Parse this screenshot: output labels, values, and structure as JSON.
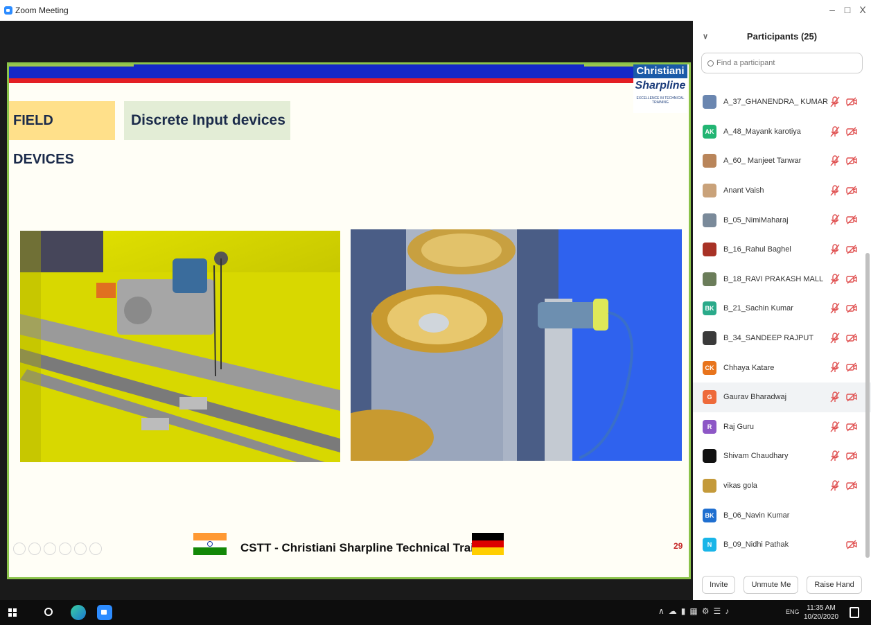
{
  "window": {
    "title": "Zoom Meeting",
    "minimize": "–",
    "restore": "□",
    "close": "X"
  },
  "slide": {
    "brand_top": "Christiani",
    "brand_mid": "Sharpline",
    "brand_small": "EXCELLENCE IN TECHNICAL TRAINING",
    "label_field": "FIELD DEVICES",
    "label_discrete": "Discrete Input devices",
    "footer_text": "CSTT - Christiani Sharpline Technical Training",
    "page_number": "29"
  },
  "panel": {
    "title": "Participants (25)",
    "search_placeholder": "Find a participant",
    "buttons": {
      "invite": "Invite",
      "unmute": "Unmute Me",
      "raise_hand": "Raise Hand"
    }
  },
  "participants": [
    {
      "name": "A_37_GHANENDRA_ KUMAR",
      "initials": "",
      "color": "#6a86b0",
      "mic": true,
      "cam": true
    },
    {
      "name": "A_48_Mayank karotiya",
      "initials": "AK",
      "color": "#22b573",
      "mic": true,
      "cam": true
    },
    {
      "name": "A_60_ Manjeet Tanwar",
      "initials": "",
      "color": "#b9855a",
      "mic": true,
      "cam": true
    },
    {
      "name": "Anant Vaish",
      "initials": "",
      "color": "#c9a27a",
      "mic": true,
      "cam": true
    },
    {
      "name": "B_05_NimiMaharaj",
      "initials": "",
      "color": "#7a8a9a",
      "mic": true,
      "cam": true
    },
    {
      "name": "B_16_Rahul Baghel",
      "initials": "",
      "color": "#a83226",
      "mic": true,
      "cam": true
    },
    {
      "name": "B_18_RAVI PRAKASH MALL",
      "initials": "",
      "color": "#6b7d5a",
      "mic": true,
      "cam": true
    },
    {
      "name": "B_21_Sachin Kumar",
      "initials": "BK",
      "color": "#2aaa8a",
      "mic": true,
      "cam": true
    },
    {
      "name": "B_34_SANDEEP RAJPUT",
      "initials": "",
      "color": "#3a3a3a",
      "mic": true,
      "cam": true
    },
    {
      "name": "Chhaya Katare",
      "initials": "CK",
      "color": "#e8741c",
      "mic": true,
      "cam": true
    },
    {
      "name": "Gaurav Bharadwaj",
      "initials": "G",
      "color": "#ee6a3a",
      "mic": true,
      "cam": true
    },
    {
      "name": "Raj Guru",
      "initials": "R",
      "color": "#8d57c6",
      "mic": true,
      "cam": true
    },
    {
      "name": "Shivam Chaudhary",
      "initials": "",
      "color": "#111111",
      "mic": true,
      "cam": true
    },
    {
      "name": "vikas gola",
      "initials": "",
      "color": "#c49a3a",
      "mic": true,
      "cam": true
    },
    {
      "name": "B_06_Navin Kumar",
      "initials": "BK",
      "color": "#1f6fd0",
      "mic": false,
      "cam": false
    },
    {
      "name": "B_09_Nidhi Pathak",
      "initials": "N",
      "color": "#19b5e8",
      "mic": false,
      "cam": true
    }
  ],
  "taskbar": {
    "lang": "ENG",
    "time": "11:35 AM",
    "date": "10/20/2020"
  },
  "colors": {
    "accent": "#2d8cff",
    "muted_icon": "#e05252",
    "slide_border": "#8bc34a"
  }
}
